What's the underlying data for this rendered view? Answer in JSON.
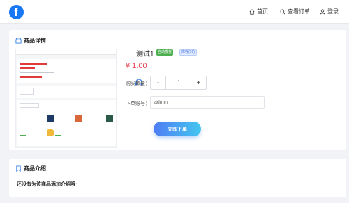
{
  "header": {
    "logo_icon": "facebook-logo",
    "nav": [
      {
        "label": "首页",
        "icon": "home-icon"
      },
      {
        "label": "查看订单",
        "icon": "search-icon"
      },
      {
        "label": "登录",
        "icon": "user-icon"
      }
    ]
  },
  "detail": {
    "title": "商品详情",
    "product_name": "测试1",
    "badges": {
      "auto": "自动发货",
      "stock": "库存(16)"
    },
    "price": "¥ 1.00",
    "quantity_label": "购买数量：",
    "quantity": {
      "minus": "-",
      "value": "1",
      "plus": "+"
    },
    "account_label": "下单账号：",
    "account_placeholder": "admin",
    "submit_label": "立即下单"
  },
  "intro": {
    "title": "商品介绍",
    "text": "还没有为该商品添加介绍哦~"
  },
  "colors": {
    "brand": "#1877f2",
    "price": "#e5404e",
    "badge_auto": "#4caf50",
    "badge_stock": "#3f6fe0",
    "button_gradient_start": "#4f7cf5",
    "button_gradient_end": "#43c6ee"
  }
}
